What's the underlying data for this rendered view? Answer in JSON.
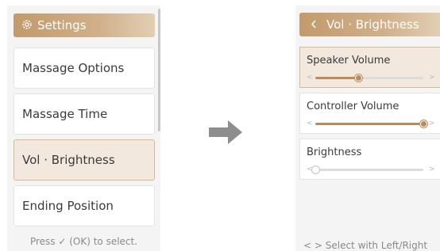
{
  "left_screen": {
    "header": {
      "title": "Settings",
      "icon": "gear-icon"
    },
    "menu_items": [
      {
        "label": "Massage Options",
        "selected": false
      },
      {
        "label": "Massage Time",
        "selected": false
      },
      {
        "label": "Vol · Brightness",
        "selected": true
      },
      {
        "label": "Ending Position",
        "selected": false
      }
    ],
    "footer": "Press ✓ (OK) to select."
  },
  "right_screen": {
    "header": {
      "back_icon": "chevron-left-icon",
      "title": "Vol · Brightness"
    },
    "controls": [
      {
        "label": "Speaker Volume",
        "level_percent": 40,
        "selected": true
      },
      {
        "label": "Controller Volume",
        "level_percent": 100,
        "selected": false
      },
      {
        "label": "Brightness",
        "level_percent": 0,
        "selected": false
      }
    ],
    "footer": "< > Select with Left/Right"
  },
  "transition_icon": "right-arrow-icon",
  "colors": {
    "accent": "#c29a6c",
    "selected_bg": "#f3e8de",
    "panel_bg": "#f4f4f4",
    "slider_fill": "#b88c5e"
  }
}
